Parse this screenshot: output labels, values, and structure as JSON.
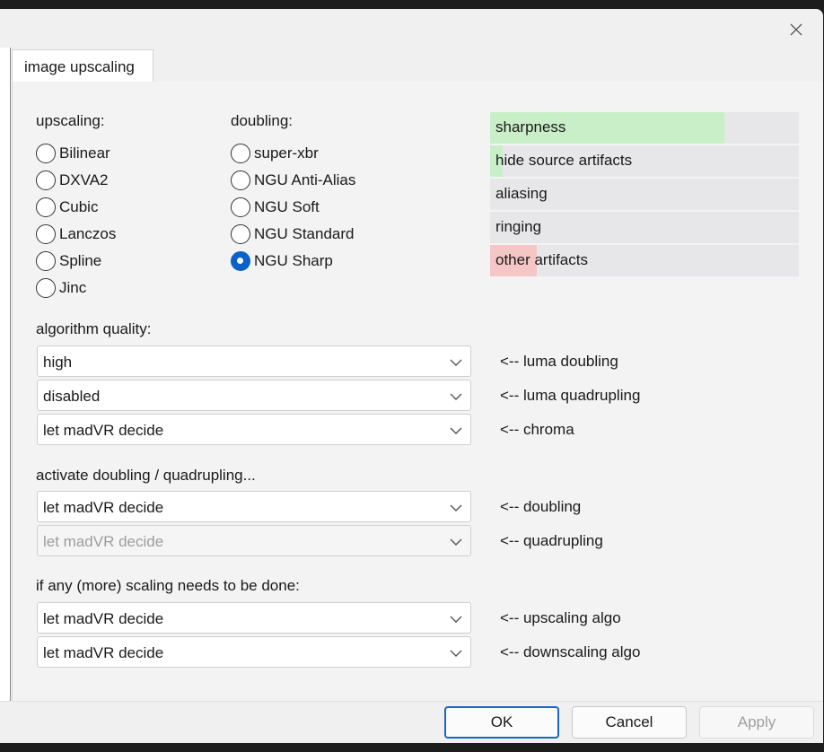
{
  "tabs": [
    {
      "label": "image upscaling",
      "active": true
    }
  ],
  "upscaling": {
    "label": "upscaling:",
    "options": [
      "Bilinear",
      "DXVA2",
      "Cubic",
      "Lanczos",
      "Spline",
      "Jinc"
    ],
    "selected": null
  },
  "doubling": {
    "label": "doubling:",
    "options": [
      "super-xbr",
      "NGU Anti-Alias",
      "NGU Soft",
      "NGU Standard",
      "NGU Sharp"
    ],
    "selected": "NGU Sharp"
  },
  "quality_meters": [
    {
      "label": "sharpness",
      "level": 0.76,
      "color": "#c9efc9"
    },
    {
      "label": "hide source artifacts",
      "level": 0.04,
      "color": "#c9efc9"
    },
    {
      "label": "aliasing",
      "level": 0.0,
      "color": "#f4c6c6"
    },
    {
      "label": "ringing",
      "level": 0.0,
      "color": "#f4c6c6"
    },
    {
      "label": "other artifacts",
      "level": 0.15,
      "color": "#f4c6c6"
    }
  ],
  "algorithm_quality": {
    "label": "algorithm quality:",
    "rows": [
      {
        "value": "high",
        "note": "<-- luma doubling",
        "disabled": false
      },
      {
        "value": "disabled",
        "note": "<-- luma quadrupling",
        "disabled": false
      },
      {
        "value": "let madVR decide",
        "note": "<-- chroma",
        "disabled": false
      }
    ]
  },
  "activate": {
    "label": "activate doubling / quadrupling...",
    "rows": [
      {
        "value": "let madVR decide",
        "note": "<-- doubling",
        "disabled": false
      },
      {
        "value": "let madVR decide",
        "note": "<-- quadrupling",
        "disabled": true
      }
    ]
  },
  "scaling": {
    "label": "if any (more) scaling needs to be done:",
    "rows": [
      {
        "value": "let madVR decide",
        "note": "<-- upscaling algo",
        "disabled": false
      },
      {
        "value": "let madVR decide",
        "note": "<-- downscaling algo",
        "disabled": false
      }
    ]
  },
  "buttons": {
    "ok": "OK",
    "cancel": "Cancel",
    "apply": "Apply"
  },
  "colors": {
    "accent": "#0a61c6",
    "good": "#c9efc9",
    "bad": "#f4c6c6"
  }
}
